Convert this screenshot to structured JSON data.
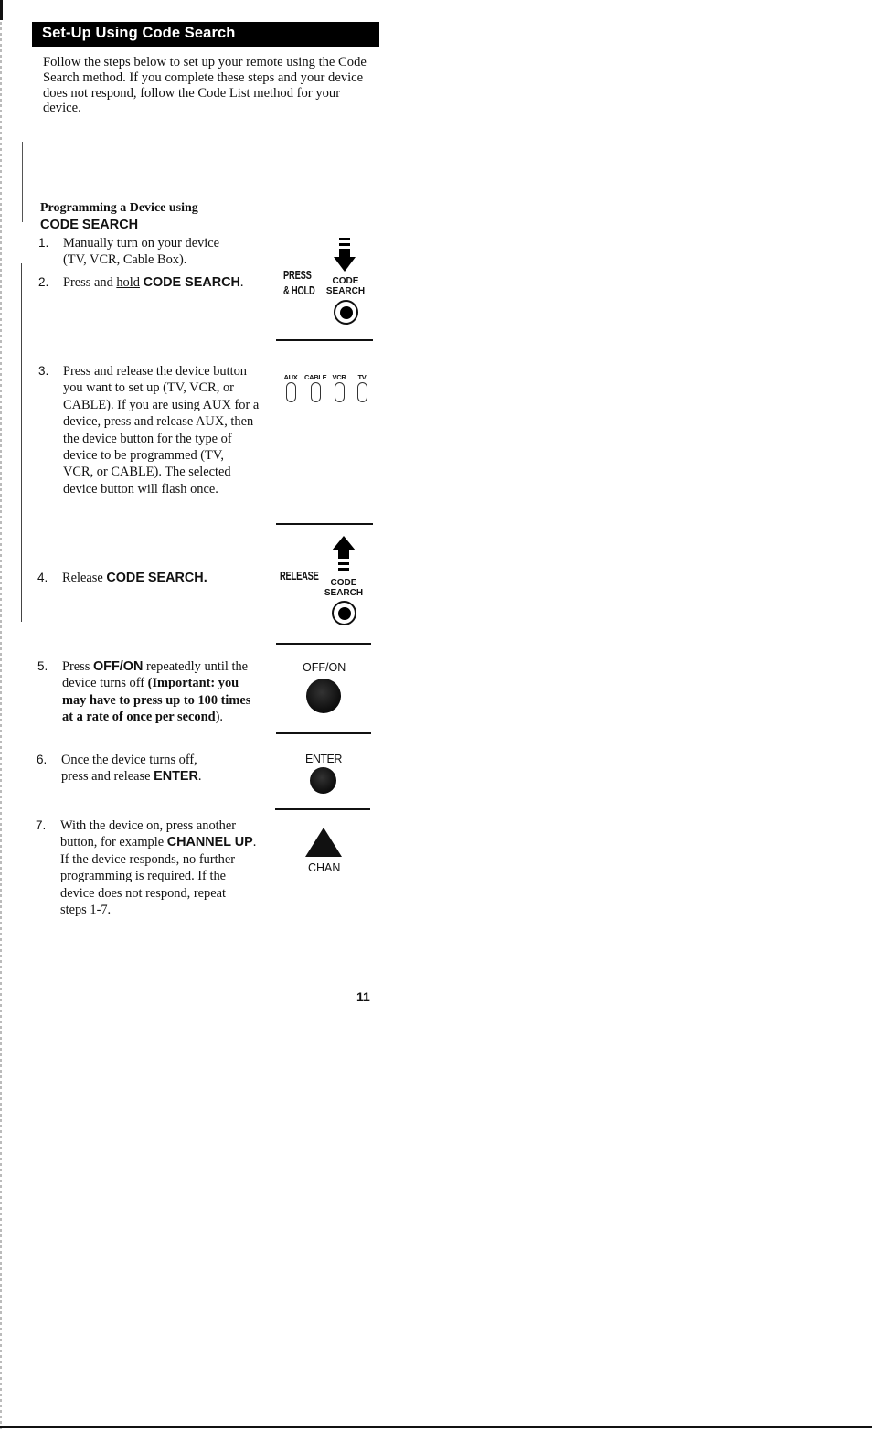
{
  "header": {
    "title": "Set-Up Using Code Search",
    "bar_color": "#000000"
  },
  "intro": "Follow the steps below to set up your remote using the Code Search method. If you complete these steps and your device does not respond, follow the Code List method for your device.",
  "section": {
    "heading_line1": "Programming a Device using",
    "heading_line2": "CODE SEARCH"
  },
  "steps": [
    {
      "number": "1.",
      "lines": [
        "Manually turn on your device",
        "(TV, VCR, Cable Box)."
      ]
    },
    {
      "number": "2.",
      "pre": "Press and ",
      "underlined": "hold",
      "bold": "CODE SEARCH",
      "post": "."
    },
    {
      "number": "3.",
      "lines": [
        "Press and release the device button",
        "you want to set up (TV, VCR, or",
        "CABLE). If you are using AUX for a",
        "device, press and release AUX, then",
        "the device button for the type of",
        "device to be programmed (TV,",
        "VCR, or CABLE).  The selected",
        "device button will flash once."
      ]
    },
    {
      "number": "4.",
      "pre": "Release ",
      "bold": "CODE SEARCH",
      "post": "."
    },
    {
      "number": "5.",
      "line1_pre": "Press ",
      "line1_bold": "OFF/ON",
      "line1_post": " repeatedly until the",
      "line2_pre": "device turns off ",
      "line2_bold": "(Important: you",
      "line3_bold": "may have to press up to 100 times",
      "line4_bold": "at a rate of once per second",
      "line4_post": ")."
    },
    {
      "number": "6.",
      "line1": "Once the device turns off,",
      "line2_pre": "press and release ",
      "line2_bold": "ENTER",
      "line2_post": "."
    },
    {
      "number": "7.",
      "line1": "With the device on, press another",
      "line2_pre": "button, for example ",
      "line2_bold": "CHANNEL UP",
      "line2_post": ".",
      "lines_rest": [
        "If the device responds, no further",
        "programming is required. If the",
        "device does not respond, repeat",
        "steps 1-7."
      ]
    }
  ],
  "illustrations": {
    "press_hold": {
      "line1": "PRESS",
      "line2": "& HOLD",
      "button_line1": "CODE",
      "button_line2": "SEARCH",
      "arrow_icon": "down-arrow-icon"
    },
    "device_buttons": [
      "AUX",
      "CABLE",
      "VCR",
      "TV"
    ],
    "release": {
      "label": "RELEASE",
      "button_line1": "CODE",
      "button_line2": "SEARCH",
      "arrow_icon": "up-arrow-icon"
    },
    "off_on": {
      "label": "OFF/ON"
    },
    "enter": {
      "label": "ENTER"
    },
    "chan": {
      "label": "CHAN"
    }
  },
  "page_number": "11"
}
